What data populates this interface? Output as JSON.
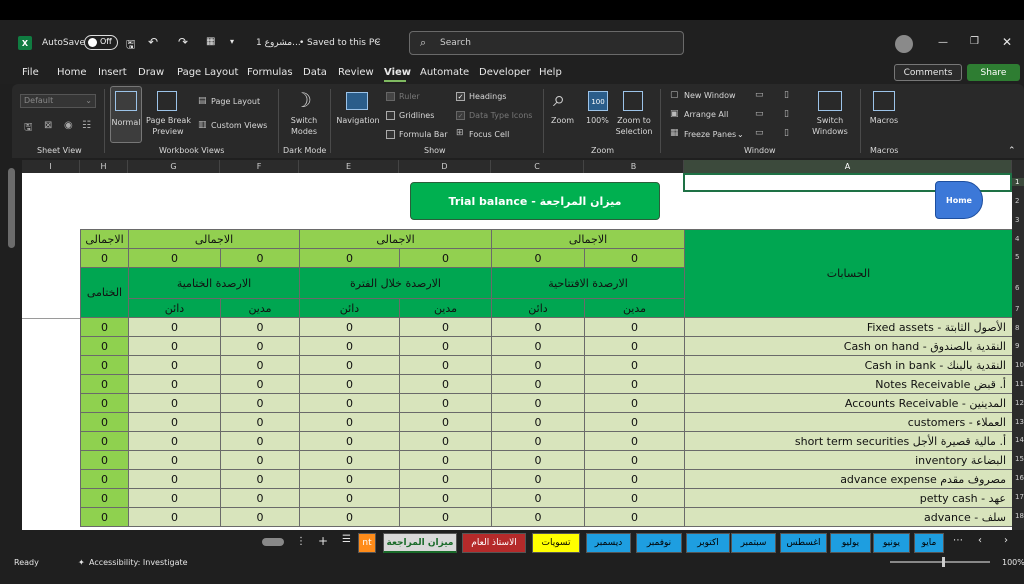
{
  "titlebar": {
    "autosave_label": "AutoSave",
    "autosave_state": "Off",
    "file_name": "مشروع 1...",
    "saved_status": "Saved to this PC",
    "search_placeholder": "Search"
  },
  "menu": [
    "File",
    "Home",
    "Insert",
    "Draw",
    "Page Layout",
    "Formulas",
    "Data",
    "Review",
    "View",
    "Automate",
    "Developer",
    "Help"
  ],
  "active_menu": "View",
  "buttons": {
    "comments": "Comments",
    "share": "Share"
  },
  "ribbon": {
    "sheet_view_dropdown": "Default",
    "groups": {
      "sheet_view": "Sheet View",
      "workbook_views": "Workbook Views",
      "dark_mode": "Dark Mode",
      "show": "Show",
      "zoom": "Zoom",
      "window": "Window",
      "macros": "Macros"
    },
    "normal": "Normal",
    "page_break_1": "Page Break",
    "page_break_2": "Preview",
    "page_layout": "Page Layout",
    "custom_views": "Custom Views",
    "switch_modes_1": "Switch",
    "switch_modes_2": "Modes",
    "navigation": "Navigation",
    "ruler": "Ruler",
    "gridlines": "Gridlines",
    "formula_bar": "Formula Bar",
    "headings": "Headings",
    "data_type_icons": "Data Type Icons",
    "focus_cell": "Focus Cell",
    "zoom": "Zoom",
    "zoom_100": "100%",
    "zoom_selection_1": "Zoom to",
    "zoom_selection_2": "Selection",
    "new_window": "New Window",
    "arrange_all": "Arrange All",
    "freeze_panes": "Freeze Panes",
    "switch_windows_1": "Switch",
    "switch_windows_2": "Windows",
    "macros": "Macros"
  },
  "columns": [
    "I",
    "H",
    "G",
    "F",
    "E",
    "D",
    "C",
    "B",
    "A"
  ],
  "rows": [
    "1",
    "2",
    "3",
    "4",
    "5",
    "6",
    "7",
    "8",
    "9",
    "10",
    "11",
    "12",
    "13",
    "14",
    "15",
    "16",
    "17",
    "18"
  ],
  "sheet": {
    "trial_button": "Trial balance - ميزان المراجعة",
    "home_button": "Home",
    "header_total": "الاجمالى",
    "header_final_total": "الختامى",
    "group_opening": "الارصدة الافتتاحية",
    "group_period": "الارصدة خلال الفترة",
    "group_closing": "الارصدة الختامية",
    "debit": "مدين",
    "credit": "دائن",
    "accounts_header": "الحسابات",
    "zero": "0",
    "accounts": [
      "الأصول الثابتة - Fixed assets",
      "النقدية بالصندوق - Cash on hand",
      "النقدية بالبنك - Cash in bank",
      "أ. قبض Notes Receivable",
      "المدينين - Accounts Receivable",
      "العملاء - customers",
      "أ. مالية قصيرة الأجل short term securities",
      "البضاعة inventory",
      "مصروف مقدم advance expense",
      "عهد - petty cash",
      "سلف - advance"
    ]
  },
  "sheet_tabs": [
    {
      "label": "nt",
      "color": "#ff8c1a",
      "text": "#ffffff"
    },
    {
      "label": "ميزان المراجعة",
      "color": "#d9d9d9",
      "text": "#1a6b2a"
    },
    {
      "label": "الاستاذ العام",
      "color": "#b52a2a",
      "text": "#ffffff"
    },
    {
      "label": "تسويات",
      "color": "#ffff00",
      "text": "#000000"
    },
    {
      "label": "ديسمبر",
      "color": "#1e9ee0",
      "text": "#000000"
    },
    {
      "label": "نوفمبر",
      "color": "#1e9ee0",
      "text": "#000000"
    },
    {
      "label": "اكتوبر",
      "color": "#1e9ee0",
      "text": "#000000"
    },
    {
      "label": "سبتمبر",
      "color": "#1e9ee0",
      "text": "#000000"
    },
    {
      "label": "اغسطس",
      "color": "#1e9ee0",
      "text": "#000000"
    },
    {
      "label": "يوليو",
      "color": "#1e9ee0",
      "text": "#000000"
    },
    {
      "label": "يونيو",
      "color": "#1e9ee0",
      "text": "#000000"
    },
    {
      "label": "مايو",
      "color": "#1e9ee0",
      "text": "#000000"
    }
  ],
  "status": {
    "ready": "Ready",
    "accessibility": "Accessibility: Investigate",
    "zoom": "100%"
  }
}
